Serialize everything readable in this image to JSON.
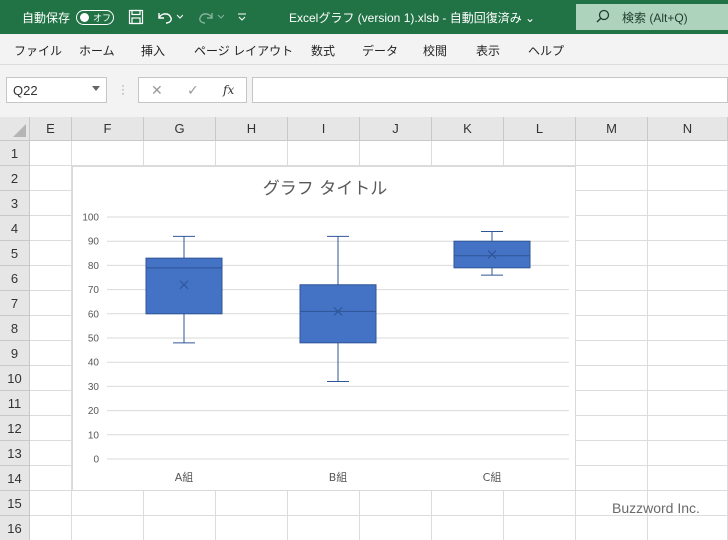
{
  "titlebar": {
    "autosave_label": "自動保存",
    "toggle_text": "オフ",
    "file_title": "Excelグラフ (version 1).xlsb  -  自動回復済み ⌄",
    "search_label": "検索 (Alt+Q)"
  },
  "ribbon": {
    "tabs": [
      "ファイル",
      "ホーム",
      "挿入",
      "ページ レイアウト",
      "数式",
      "データ",
      "校閲",
      "表示",
      "ヘルプ"
    ]
  },
  "formula_bar": {
    "name_box": "Q22",
    "cancel_glyph": "✕",
    "enter_glyph": "✓",
    "fx_label": "fx",
    "formula": ""
  },
  "sheet": {
    "columns": [
      "E",
      "F",
      "G",
      "H",
      "I",
      "J",
      "K",
      "L",
      "M",
      "N"
    ],
    "rows": [
      "1",
      "2",
      "3",
      "4",
      "5",
      "6",
      "7",
      "8",
      "9",
      "10",
      "11",
      "12",
      "13",
      "14",
      "15",
      "16"
    ]
  },
  "chart_data": {
    "type": "boxplot",
    "title": "グラフ タイトル",
    "categories": [
      "A組",
      "B組",
      "C組"
    ],
    "boxes": [
      {
        "min": 48,
        "q1": 60,
        "median": 79,
        "q3": 83,
        "max": 92,
        "mean": 72
      },
      {
        "min": 32,
        "q1": 48,
        "median": 61,
        "q3": 72,
        "max": 92,
        "mean": 61
      },
      {
        "min": 76,
        "q1": 79,
        "median": 84,
        "q3": 90,
        "max": 94,
        "mean": 84.5
      }
    ],
    "ylim": [
      0,
      100
    ],
    "yticks": [
      0,
      10,
      20,
      30,
      40,
      50,
      60,
      70,
      80,
      90,
      100
    ],
    "grid": true,
    "colors": {
      "box_fill": "#4472C4",
      "box_stroke": "#2F5597",
      "grid": "#d9d9d9",
      "axis_text": "#595959"
    }
  },
  "watermark": "Buzzword Inc.",
  "colors": {
    "titlebar": "#217346",
    "ribbon": "#f3f3f3"
  }
}
